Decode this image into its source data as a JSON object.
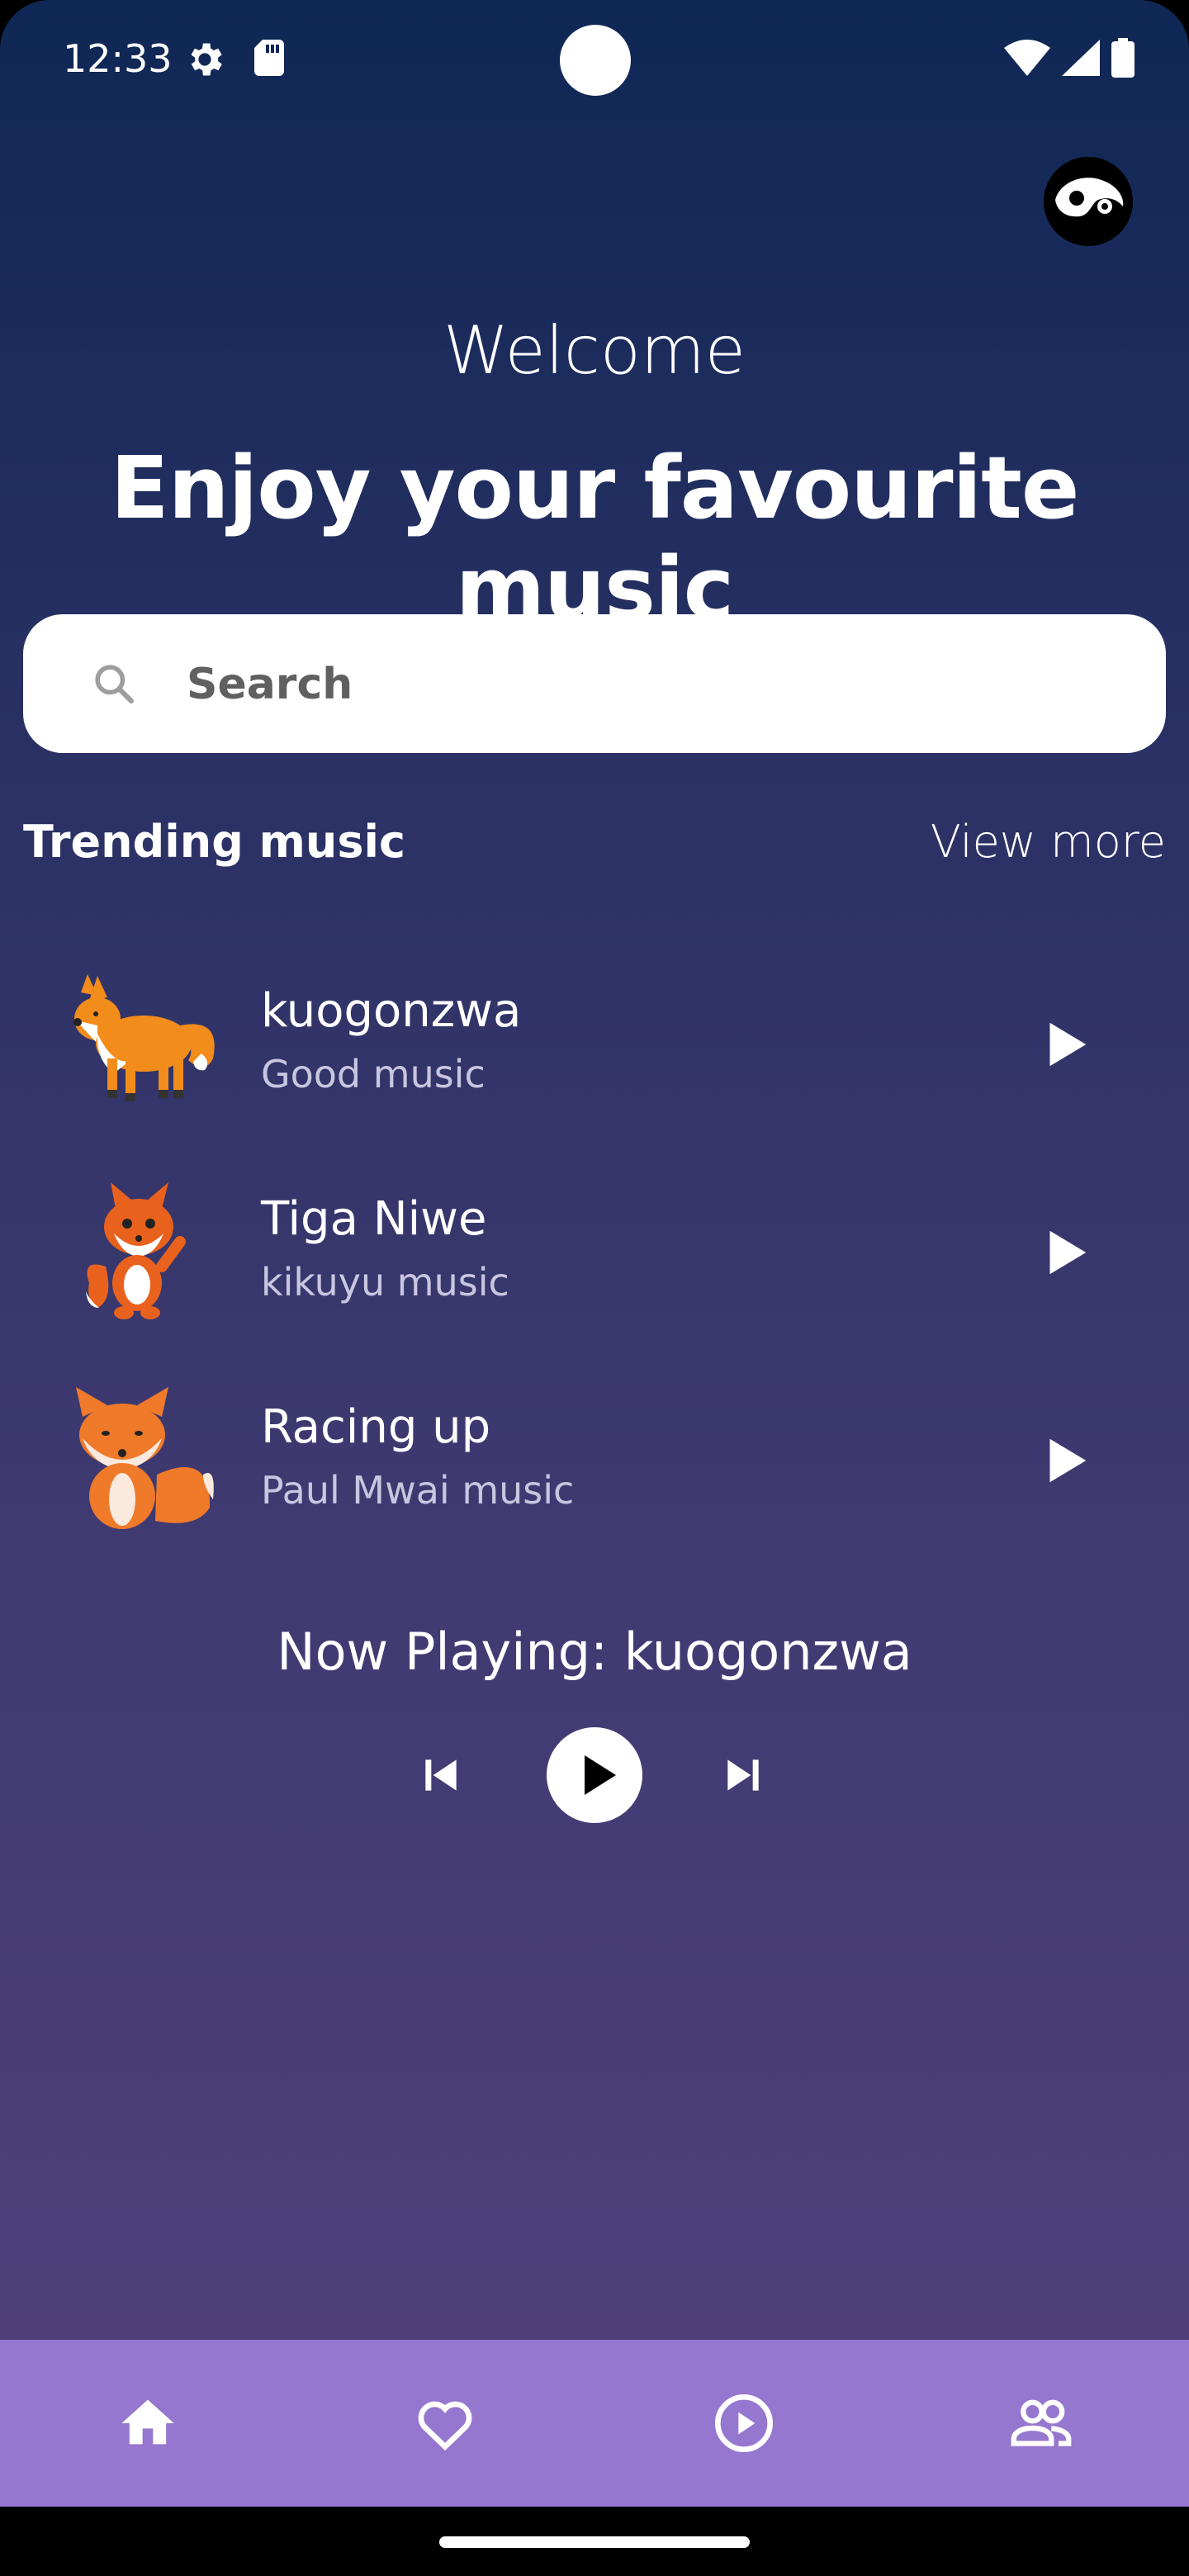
{
  "status_bar": {
    "time": "12:33",
    "icons": [
      "settings-gear-icon",
      "sd-card-icon",
      "wifi-icon",
      "signal-icon",
      "battery-icon"
    ]
  },
  "header": {
    "welcome": "Welcome",
    "headline": "Enjoy your favourite music"
  },
  "search": {
    "placeholder": "Search"
  },
  "trending": {
    "title": "Trending music",
    "view_more": "View more",
    "tracks": [
      {
        "title": "kuogonzwa",
        "subtitle": "Good music",
        "icon": "fox-walking"
      },
      {
        "title": "Tiga Niwe",
        "subtitle": "kikuyu music",
        "icon": "fox-waving"
      },
      {
        "title": "Racing up",
        "subtitle": "Paul Mwai music",
        "icon": "fox-sitting"
      }
    ]
  },
  "player": {
    "now_playing": "Now Playing: kuogonzwa"
  },
  "bottom_nav": {
    "items": [
      "home-icon",
      "favorite-icon",
      "play-circle-icon",
      "people-icon"
    ],
    "active": "home-icon"
  },
  "colors": {
    "bg_top": "#0f2755",
    "bg_bottom": "#4e3f7b",
    "nav_bg": "#9677cf",
    "text": "#ffffff",
    "subtitle": "#c9c6e0"
  }
}
